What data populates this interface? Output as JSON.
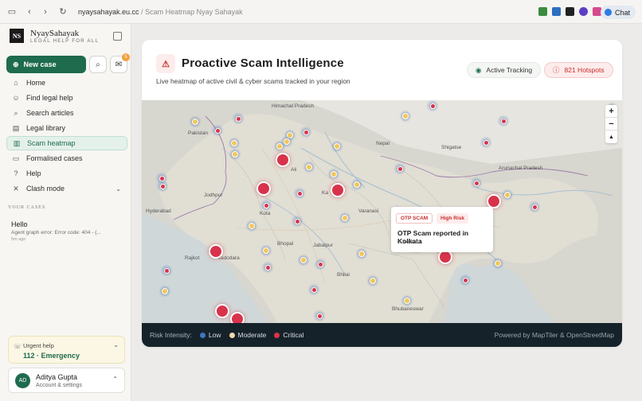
{
  "browser": {
    "domain": "nyaysahayak.eu.cc",
    "path": "/ Scam Heatmap Nyay Sahayak",
    "chat_label": "Chat"
  },
  "sidebar": {
    "brand": "NyaySahayak",
    "tagline": "LEGAL HELP FOR ALL",
    "new_case": "New case",
    "inbox_badge": "5",
    "nav": [
      {
        "label": "Home",
        "icon": "home-icon"
      },
      {
        "label": "Find legal help",
        "icon": "people-icon"
      },
      {
        "label": "Search articles",
        "icon": "search-icon"
      },
      {
        "label": "Legal library",
        "icon": "book-icon"
      },
      {
        "label": "Scam heatmap",
        "icon": "map-icon"
      },
      {
        "label": "Formalised cases",
        "icon": "folder-icon"
      },
      {
        "label": "Help",
        "icon": "help-icon"
      },
      {
        "label": "Clash mode",
        "icon": "swords-icon"
      }
    ],
    "section_title": "YOUR CASES",
    "history": [
      {
        "title": "Hello",
        "sub": "Agent graph error: Error code: 404 - {...",
        "time": "5m ago"
      }
    ],
    "urgent": {
      "title": "Urgent help",
      "number": "112 · Emergency"
    },
    "user": {
      "initials": "AD",
      "name": "Aditya Gupta",
      "sub": "Account & settings"
    }
  },
  "main": {
    "title": "Proactive Scam Intelligence",
    "subtitle": "Live heatmap of active civil & cyber scams tracked in your region",
    "tracking_label": "Active Tracking",
    "hotspots_label": "821 Hotspots",
    "popup": {
      "tag1": "OTP SCAM",
      "tag2": "High Risk",
      "title": "OTP Scam reported in Kolkata",
      "location": "Kolkata"
    },
    "map_labels": [
      "Himachal Pradesh",
      "Pakistan",
      "Nepal",
      "Shigatse",
      "Arunachal Pradesh",
      "Jodhpur",
      "Kota",
      "Varanasi",
      "Hyderabad",
      "Bhopal",
      "Jabalpur",
      "Rajkot",
      "Vadodara",
      "Bhilai",
      "Bhubaneswar",
      "Ali",
      "Ka"
    ],
    "legend": {
      "label": "Risk Intensity:",
      "low": "Low",
      "moderate": "Moderate",
      "critical": "Critical",
      "powered": "Powered by MapTiler & OpenStreetMap"
    },
    "colors": {
      "low": "#3a78c2",
      "moderate": "#f0d9a8",
      "critical": "#d8334a",
      "brand": "#1e6b4e"
    }
  }
}
